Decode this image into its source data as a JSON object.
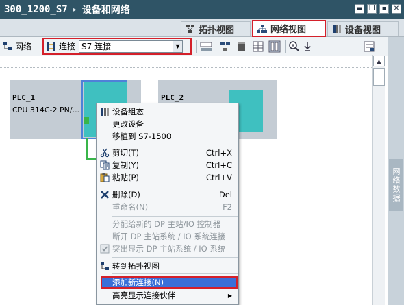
{
  "window": {
    "project": "300_1200_S7",
    "separator": "▸",
    "title": "设备和网络"
  },
  "window_controls": [
    "▬",
    "❐",
    "▪",
    "✕"
  ],
  "view_tabs": [
    {
      "label": "拓扑视图",
      "active": false
    },
    {
      "label": "网络视图",
      "active": true
    },
    {
      "label": "设备视图",
      "active": false
    }
  ],
  "toolbar": {
    "network_label": "网络",
    "connection_label": "连接",
    "connection_type": "S7 连接"
  },
  "side_panel": {
    "label": "网络数据"
  },
  "devices": [
    {
      "name": "PLC_1",
      "type": "CPU 314C-2 PN/..."
    },
    {
      "name": "PLC_2"
    }
  ],
  "context_menu": {
    "items": [
      {
        "label": "设备组态",
        "key": "",
        "enabled": true,
        "icon": "device-config-icon"
      },
      {
        "label": "更改设备",
        "key": "",
        "enabled": true
      },
      {
        "label": "移植到 S7-1500",
        "key": "",
        "enabled": true
      },
      {
        "label": "剪切(T)",
        "key": "Ctrl+X",
        "enabled": true,
        "icon": "scissors-icon"
      },
      {
        "label": "复制(Y)",
        "key": "Ctrl+C",
        "enabled": true,
        "icon": "copy-icon"
      },
      {
        "label": "粘贴(P)",
        "key": "Ctrl+V",
        "enabled": true,
        "icon": "paste-icon"
      },
      {
        "label": "删除(D)",
        "key": "Del",
        "enabled": true,
        "icon": "delete-icon"
      },
      {
        "label": "重命名(N)",
        "key": "F2",
        "enabled": false
      },
      {
        "label": "分配给新的 DP 主站/IO 控制器",
        "key": "",
        "enabled": false
      },
      {
        "label": "断开 DP 主站系统 / IO 系统连接",
        "key": "",
        "enabled": false
      },
      {
        "label": "突出显示 DP 主站系统 / IO 系统",
        "key": "",
        "enabled": false,
        "icon": "checkbox-icon"
      },
      {
        "label": "转到拓扑视图",
        "key": "",
        "enabled": true,
        "icon": "topology-icon"
      },
      {
        "label": "添加新连接(N)",
        "key": "",
        "enabled": true,
        "highlighted": true
      },
      {
        "label": "高亮显示连接伙伴",
        "key": "▶",
        "enabled": true
      }
    ]
  },
  "colors": {
    "titlebar": "#2f5466",
    "highlight": "#3a6fd8",
    "callout": "#d4202a",
    "module": "#3fc0c0"
  }
}
